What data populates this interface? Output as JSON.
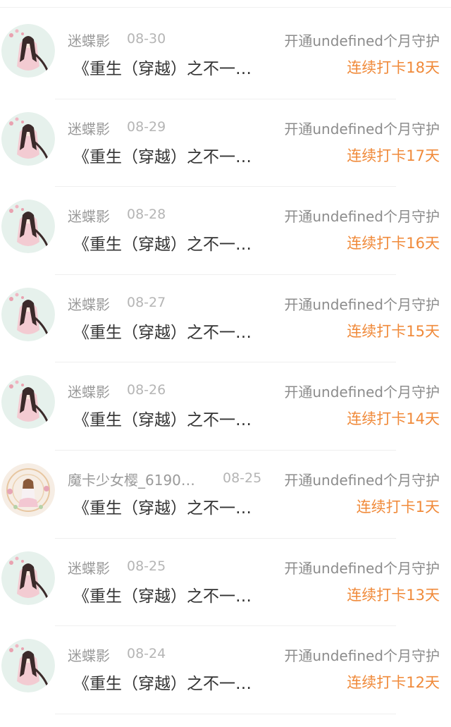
{
  "records": [
    {
      "user": "迷蝶影",
      "date": "08-30",
      "gift": "开通undefined个月守护",
      "book": "《重生（穿越）之不一…",
      "streak": "连续打卡18天",
      "avatar": "pink-ancient-girl-avatar"
    },
    {
      "user": "迷蝶影",
      "date": "08-29",
      "gift": "开通undefined个月守护",
      "book": "《重生（穿越）之不一…",
      "streak": "连续打卡17天",
      "avatar": "pink-ancient-girl-avatar"
    },
    {
      "user": "迷蝶影",
      "date": "08-28",
      "gift": "开通undefined个月守护",
      "book": "《重生（穿越）之不一…",
      "streak": "连续打卡16天",
      "avatar": "pink-ancient-girl-avatar"
    },
    {
      "user": "迷蝶影",
      "date": "08-27",
      "gift": "开通undefined个月守护",
      "book": "《重生（穿越）之不一…",
      "streak": "连续打卡15天",
      "avatar": "pink-ancient-girl-avatar"
    },
    {
      "user": "迷蝶影",
      "date": "08-26",
      "gift": "开通undefined个月守护",
      "book": "《重生（穿越）之不一…",
      "streak": "连续打卡14天",
      "avatar": "pink-ancient-girl-avatar"
    },
    {
      "user": "魔卡少女樱_6190…",
      "date": "08-25",
      "gift": "开通undefined个月守护",
      "book": "《重生（穿越）之不一…",
      "streak": "连续打卡1天",
      "avatar": "magic-girl-avatar"
    },
    {
      "user": "迷蝶影",
      "date": "08-25",
      "gift": "开通undefined个月守护",
      "book": "《重生（穿越）之不一…",
      "streak": "连续打卡13天",
      "avatar": "pink-ancient-girl-avatar"
    },
    {
      "user": "迷蝶影",
      "date": "08-24",
      "gift": "开通undefined个月守护",
      "book": "《重生（穿越）之不一…",
      "streak": "连续打卡12天",
      "avatar": "pink-ancient-girl-avatar"
    }
  ],
  "colors": {
    "streak": "#f08a3a",
    "name": "#9a9a9a",
    "text": "#333333"
  }
}
